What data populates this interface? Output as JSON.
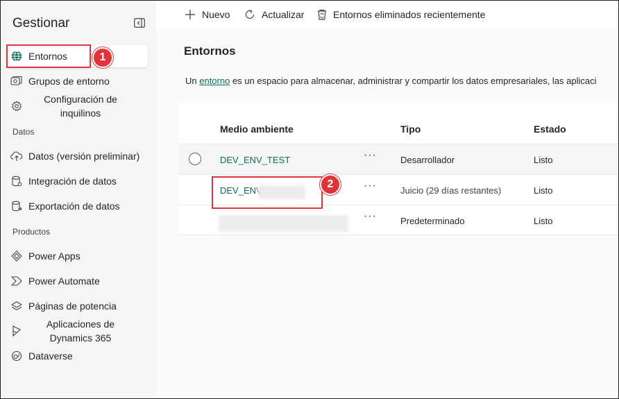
{
  "sidebar": {
    "title": "Gestionar",
    "items": [
      {
        "label": "Entornos",
        "icon": "globe-icon",
        "selected": true
      },
      {
        "label": "Grupos de entorno",
        "icon": "environment-groups-icon"
      },
      {
        "label": "Configuración de inquilinos",
        "icon": "gear-icon"
      }
    ],
    "section_datos": "Datos",
    "datos_items": [
      {
        "label": "Datos (versión preliminar)",
        "icon": "cloud-upload-icon"
      },
      {
        "label": "Integración de datos",
        "icon": "database-icon"
      },
      {
        "label": "Exportación de datos",
        "icon": "database-export-icon"
      }
    ],
    "section_productos": "Productos",
    "productos_items": [
      {
        "label": "Power Apps",
        "icon": "power-apps-icon"
      },
      {
        "label": "Power Automate",
        "icon": "power-automate-icon"
      },
      {
        "label": "Páginas de potencia",
        "icon": "power-pages-icon"
      },
      {
        "label": "Aplicaciones de Dynamics 365",
        "icon": "dynamics-icon"
      },
      {
        "label": "Dataverse",
        "icon": "dataverse-icon"
      }
    ]
  },
  "toolbar": {
    "new_label": "Nuevo",
    "refresh_label": "Actualizar",
    "deleted_label": "Entornos eliminados recientemente"
  },
  "main": {
    "title": "Entornos",
    "desc_prefix": "Un ",
    "desc_link": "entorno",
    "desc_suffix": " es un espacio para almacenar, administrar y compartir los datos empresariales, las aplicaci"
  },
  "table": {
    "headers": [
      "Medio ambiente",
      "Tipo",
      "Estado"
    ],
    "rows": [
      {
        "name": "DEV_ENV_TEST",
        "type": "Desarrollador",
        "state": "Listo"
      },
      {
        "name": "DEV_ENV_",
        "type": "Juicio (29 días restantes)",
        "state": "Listo"
      },
      {
        "name": "",
        "type": "Predeterminado",
        "state": "Listo"
      }
    ],
    "more": "···"
  },
  "annotations": {
    "badge1": "1",
    "badge2": "2",
    "color": "#e0343a"
  },
  "colors": {
    "accent": "#0f6b5c",
    "sidebar_bg": "#f5f5f5"
  }
}
